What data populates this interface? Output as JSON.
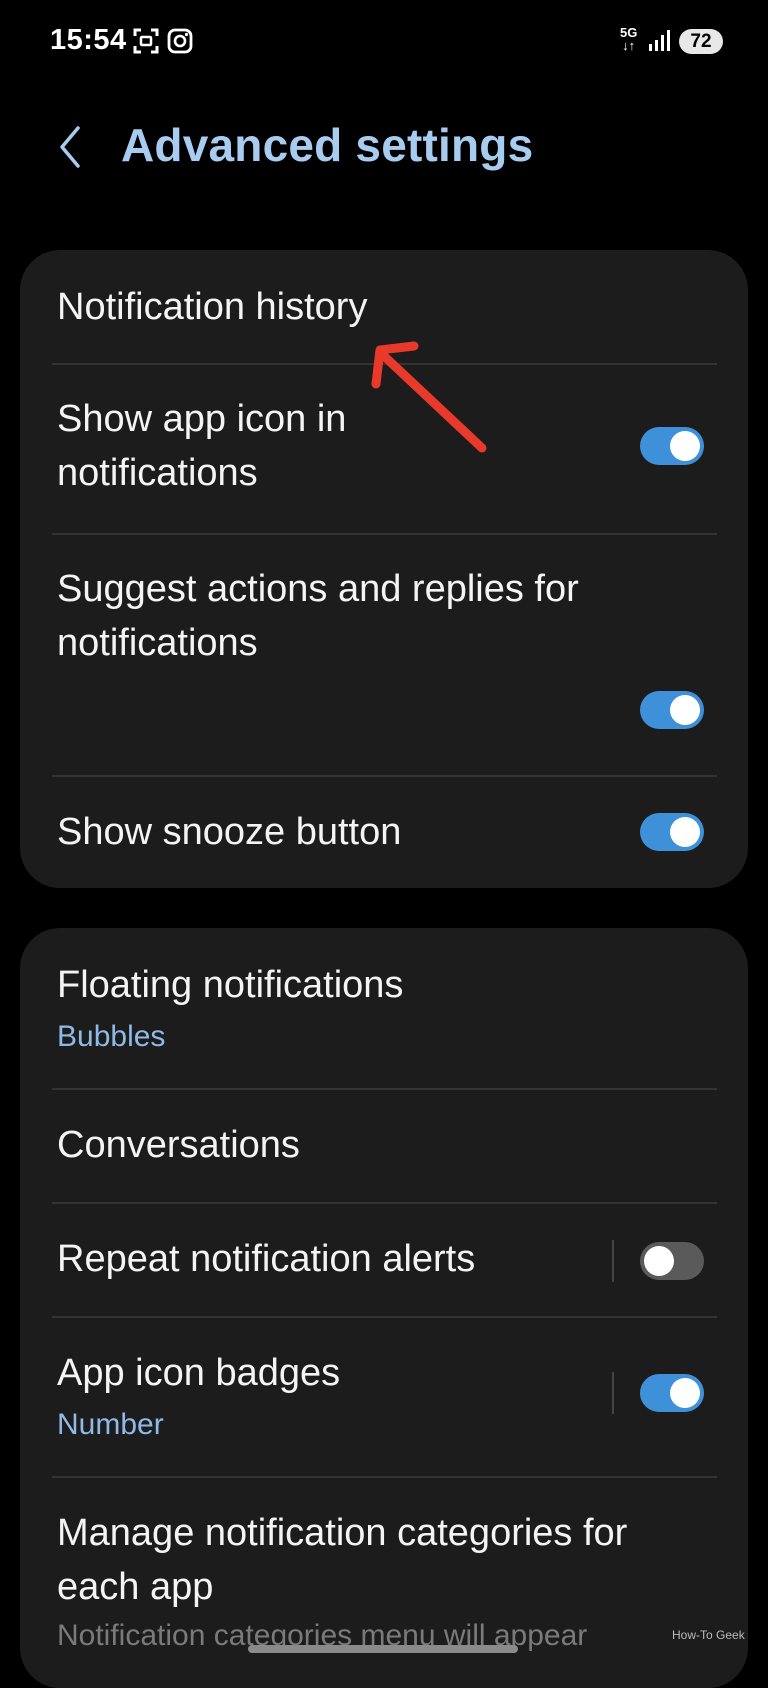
{
  "status_bar": {
    "time": "15:54",
    "network": "5G",
    "battery": "72"
  },
  "header": {
    "title": "Advanced settings"
  },
  "card1": {
    "items": [
      {
        "title": "Notification history"
      },
      {
        "title_line1": "Show app icon in",
        "title_line2": "notifications",
        "toggle": true
      },
      {
        "title_line1": "Suggest actions and replies for",
        "title_line2": "notifications",
        "toggle": true
      },
      {
        "title": "Show snooze button",
        "toggle": true
      }
    ]
  },
  "card2": {
    "items": [
      {
        "title": "Floating notifications",
        "subtitle": "Bubbles"
      },
      {
        "title": "Conversations"
      },
      {
        "title": "Repeat notification alerts",
        "toggle": false
      },
      {
        "title": "App icon badges",
        "subtitle": "Number",
        "toggle": true
      },
      {
        "title_line1": "Manage notification categories for",
        "title_line2": "each app",
        "subtitle": "Notification categories menu will appear"
      }
    ]
  },
  "watermark": "How-To Geek",
  "colors": {
    "accent": "#a8ccef",
    "toggle_on": "#3e91d9",
    "annotation_arrow": "#e8392b"
  }
}
